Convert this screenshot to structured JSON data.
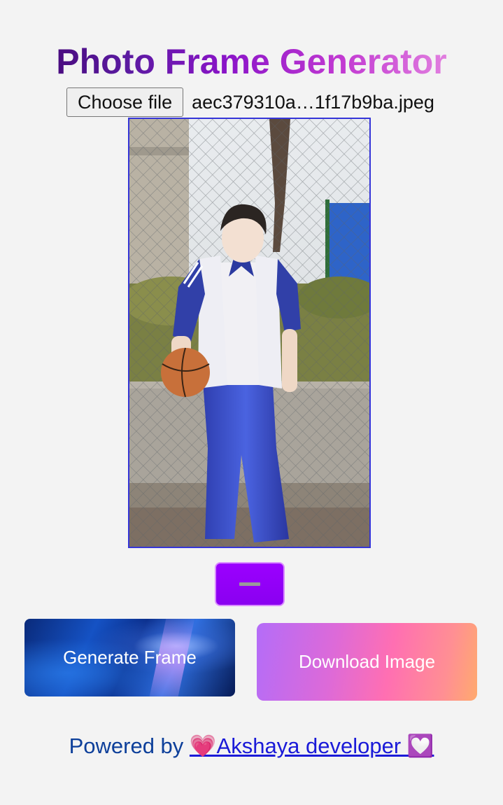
{
  "header": {
    "title": "Photo Frame Generator"
  },
  "file_input": {
    "button_label": "Choose file",
    "file_name": "aec379310a…1f17b9ba.jpeg"
  },
  "preview": {
    "border_color": "#3535d8"
  },
  "toggle": {
    "icon": "minus-icon",
    "color": "#9b00ff"
  },
  "actions": {
    "generate_label": "Generate Frame",
    "download_label": "Download Image"
  },
  "footer": {
    "prefix": "Powered by",
    "link_text": "💗Akshaya developer 💟"
  }
}
